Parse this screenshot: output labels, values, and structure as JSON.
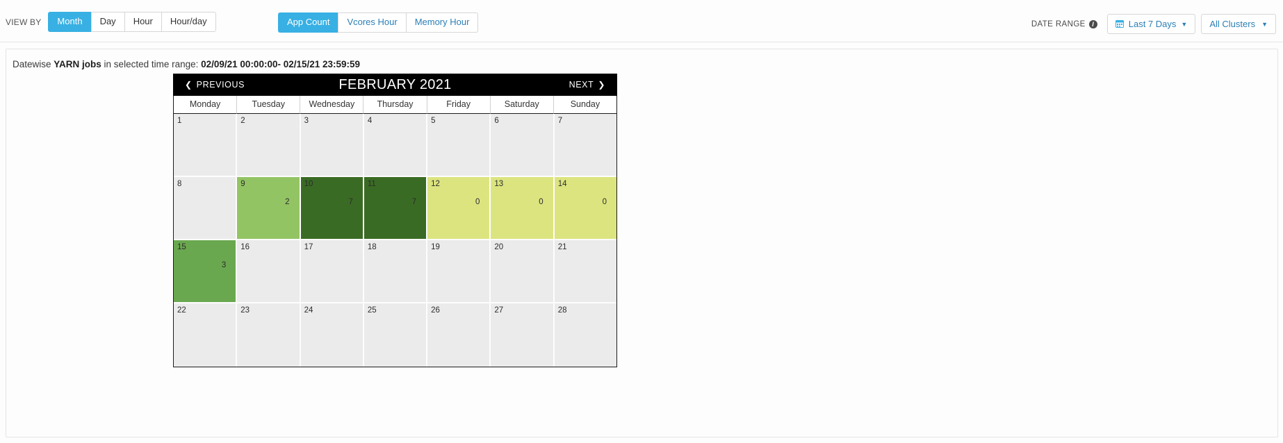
{
  "toolbar": {
    "view_by_label": "VIEW BY",
    "view_by_options": [
      {
        "label": "Month",
        "active": true
      },
      {
        "label": "Day",
        "active": false
      },
      {
        "label": "Hour",
        "active": false
      },
      {
        "label": "Hour/day",
        "active": false
      }
    ],
    "metric_options": [
      {
        "label": "App Count",
        "active": true
      },
      {
        "label": "Vcores Hour",
        "active": false
      },
      {
        "label": "Memory Hour",
        "active": false
      }
    ],
    "date_range_label": "DATE RANGE",
    "info_glyph": "i",
    "date_range_value": "Last 7 Days",
    "calendar_glyph": "Ὄ5",
    "cluster_value": "All Clusters",
    "caret_glyph": "▾",
    "accent_color": "#38b0e3",
    "link_color": "#2b7fb5"
  },
  "panel": {
    "subtitle_prefix": "Datewise ",
    "subtitle_strong": "YARN jobs",
    "subtitle_middle": " in selected time range: ",
    "subtitle_range": "02/09/21 00:00:00- 02/15/21 23:59:59"
  },
  "calendar": {
    "previous_label": "PREVIOUS",
    "next_label": "NEXT",
    "prev_chevron": "❮",
    "next_chevron": "❯",
    "title": "FEBRUARY 2021",
    "weekdays": [
      "Monday",
      "Tuesday",
      "Wednesday",
      "Thursday",
      "Friday",
      "Saturday",
      "Sunday"
    ],
    "weeks": [
      [
        {
          "day": "1",
          "value": "",
          "color": "#ebebeb"
        },
        {
          "day": "2",
          "value": "",
          "color": "#ebebeb"
        },
        {
          "day": "3",
          "value": "",
          "color": "#ebebeb"
        },
        {
          "day": "4",
          "value": "",
          "color": "#ebebeb"
        },
        {
          "day": "5",
          "value": "",
          "color": "#ebebeb"
        },
        {
          "day": "6",
          "value": "",
          "color": "#ebebeb"
        },
        {
          "day": "7",
          "value": "",
          "color": "#ebebeb"
        }
      ],
      [
        {
          "day": "8",
          "value": "",
          "color": "#ebebeb"
        },
        {
          "day": "9",
          "value": "2",
          "color": "#93c464"
        },
        {
          "day": "10",
          "value": "7",
          "color": "#3a6b24"
        },
        {
          "day": "11",
          "value": "7",
          "color": "#3a6b24"
        },
        {
          "day": "12",
          "value": "0",
          "color": "#dce47f"
        },
        {
          "day": "13",
          "value": "0",
          "color": "#dce47f"
        },
        {
          "day": "14",
          "value": "0",
          "color": "#dce47f"
        }
      ],
      [
        {
          "day": "15",
          "value": "3",
          "color": "#6aa84f"
        },
        {
          "day": "16",
          "value": "",
          "color": "#ebebeb"
        },
        {
          "day": "17",
          "value": "",
          "color": "#ebebeb"
        },
        {
          "day": "18",
          "value": "",
          "color": "#ebebeb"
        },
        {
          "day": "19",
          "value": "",
          "color": "#ebebeb"
        },
        {
          "day": "20",
          "value": "",
          "color": "#ebebeb"
        },
        {
          "day": "21",
          "value": "",
          "color": "#ebebeb"
        }
      ],
      [
        {
          "day": "22",
          "value": "",
          "color": "#ebebeb"
        },
        {
          "day": "23",
          "value": "",
          "color": "#ebebeb"
        },
        {
          "day": "24",
          "value": "",
          "color": "#ebebeb"
        },
        {
          "day": "25",
          "value": "",
          "color": "#ebebeb"
        },
        {
          "day": "26",
          "value": "",
          "color": "#ebebeb"
        },
        {
          "day": "27",
          "value": "",
          "color": "#ebebeb"
        },
        {
          "day": "28",
          "value": "",
          "color": "#ebebeb"
        }
      ]
    ]
  },
  "chart_data": {
    "type": "heatmap",
    "title": "FEBRUARY 2021",
    "metric": "App Count",
    "xlabel": "",
    "ylabel": "",
    "categories": [
      "Monday",
      "Tuesday",
      "Wednesday",
      "Thursday",
      "Friday",
      "Saturday",
      "Sunday"
    ],
    "points": [
      {
        "date": "2021-02-09",
        "day": 9,
        "value": 2
      },
      {
        "date": "2021-02-10",
        "day": 10,
        "value": 7
      },
      {
        "date": "2021-02-11",
        "day": 11,
        "value": 7
      },
      {
        "date": "2021-02-12",
        "day": 12,
        "value": 0
      },
      {
        "date": "2021-02-13",
        "day": 13,
        "value": 0
      },
      {
        "date": "2021-02-14",
        "day": 14,
        "value": 0
      },
      {
        "date": "2021-02-15",
        "day": 15,
        "value": 3
      }
    ],
    "value_range": [
      0,
      7
    ],
    "colorscale": [
      "#dce47f",
      "#93c464",
      "#6aa84f",
      "#3a6b24"
    ],
    "empty_color": "#ebebeb",
    "legend": "none",
    "grid": true
  }
}
